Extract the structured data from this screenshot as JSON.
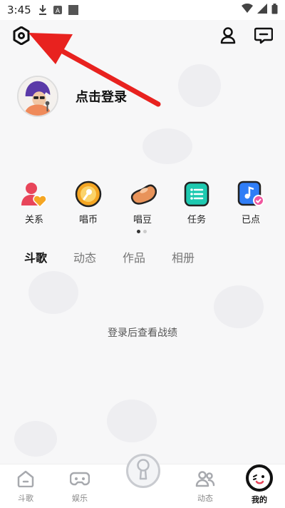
{
  "status_bar": {
    "time": "3:45"
  },
  "profile": {
    "login_text": "点击登录"
  },
  "quick_actions": [
    {
      "label": "关系",
      "icon": "relationship-icon"
    },
    {
      "label": "唱币",
      "icon": "sing-coin-icon"
    },
    {
      "label": "唱豆",
      "icon": "sing-bean-icon"
    },
    {
      "label": "任务",
      "icon": "task-icon"
    },
    {
      "label": "已点",
      "icon": "ordered-songs-icon"
    }
  ],
  "tabs": [
    {
      "label": "斗歌",
      "active": true
    },
    {
      "label": "动态",
      "active": false
    },
    {
      "label": "作品",
      "active": false
    },
    {
      "label": "相册",
      "active": false
    }
  ],
  "empty_message": "登录后查看战绩",
  "bottom_nav": [
    {
      "label": "斗歌",
      "icon": "home-icon"
    },
    {
      "label": "娱乐",
      "icon": "gamepad-icon"
    },
    {
      "label": "",
      "icon": "microphone-icon"
    },
    {
      "label": "动态",
      "icon": "people-icon"
    },
    {
      "label": "我的",
      "icon": "profile-face-icon"
    }
  ],
  "colors": {
    "accent_arrow": "#e8221f",
    "coin": "#f5a623",
    "task": "#1ec9b0",
    "ordered": "#2f7df6"
  }
}
